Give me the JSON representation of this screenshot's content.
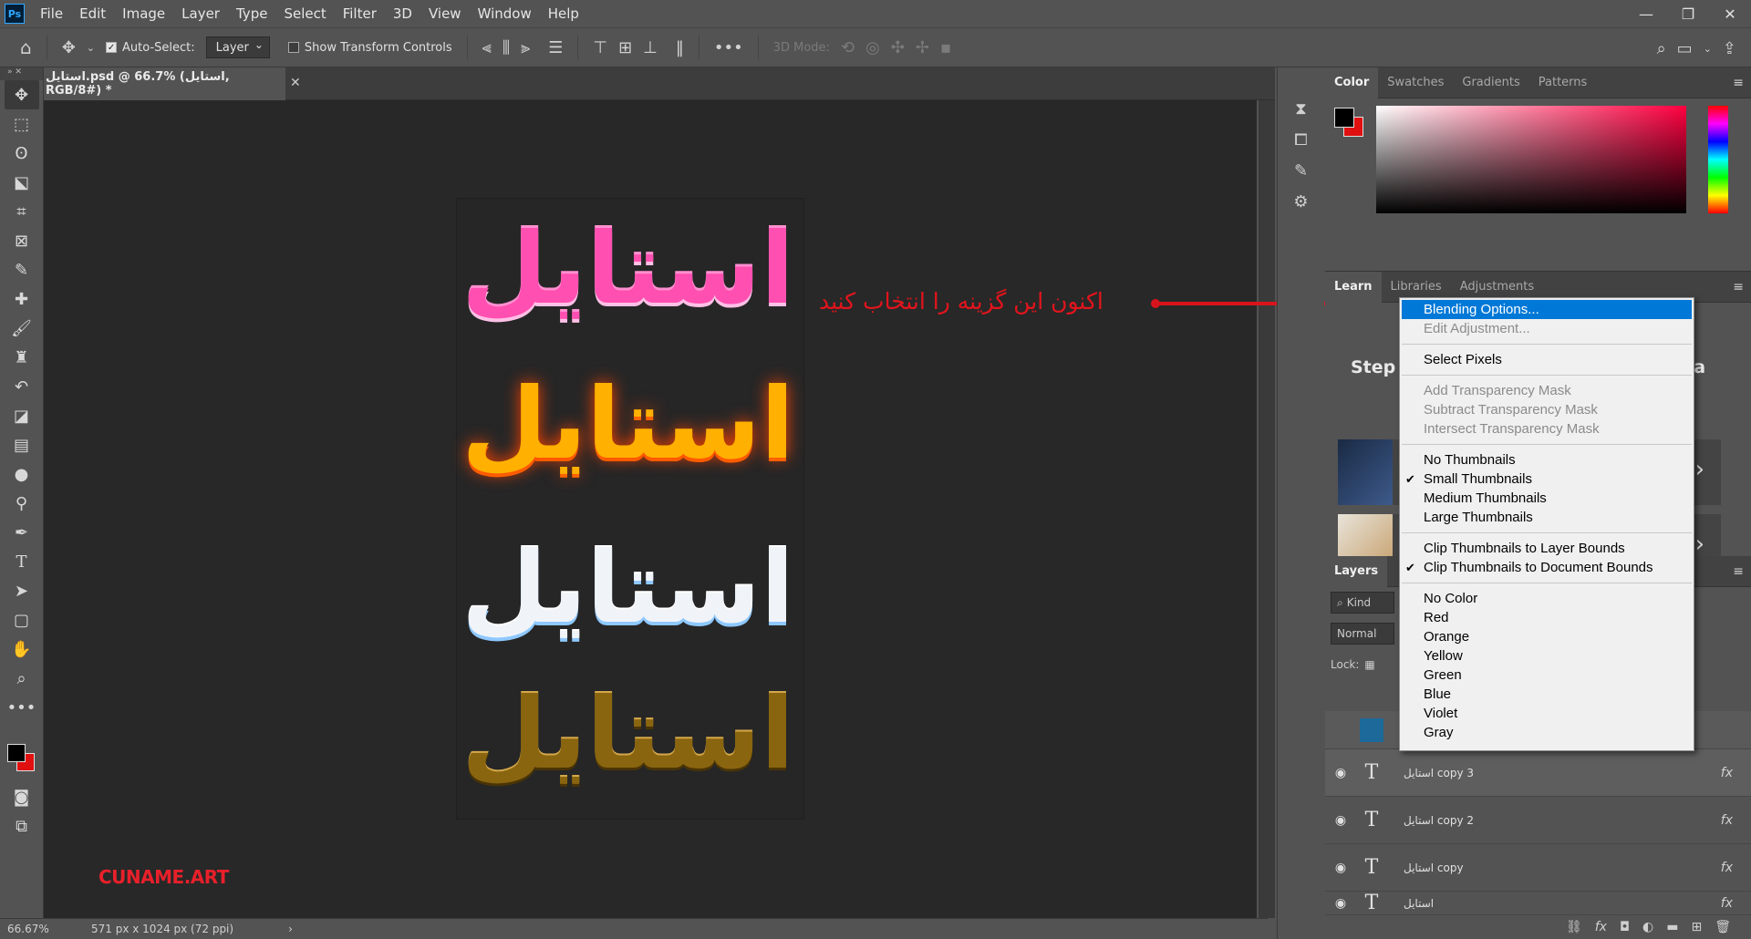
{
  "menubar": {
    "logo": "Ps",
    "items": [
      "File",
      "Edit",
      "Image",
      "Layer",
      "Type",
      "Select",
      "Filter",
      "3D",
      "View",
      "Window",
      "Help"
    ],
    "window_controls": [
      "—",
      "❐",
      "✕"
    ]
  },
  "options": {
    "auto_select_label": "Auto-Select:",
    "layer_select": "Layer",
    "transform_label": "Show Transform Controls",
    "mode_label": "3D Mode:"
  },
  "document": {
    "tab_title": "استایل.psd @ 66.7% (استایل, RGB/8#) *",
    "art_text": "استایل",
    "watermark": "CUNAME.ART"
  },
  "annotation": {
    "text": "اکنون این گزینه را انتخاب کنید",
    "color": "#e3141c"
  },
  "status": {
    "zoom": "66.67%",
    "doc_info": "571 px x 1024 px (72 ppi)",
    "arrow": "›"
  },
  "panels": {
    "color_tabs": [
      "Color",
      "Swatches",
      "Gradients",
      "Patterns"
    ],
    "learn_tabs": [
      "Learn",
      "Libraries",
      "Adjustments"
    ],
    "learn_step": "Step",
    "learn_tail": "k a",
    "layers_tab": "Layers",
    "kind_label": "Kind",
    "blend_mode": "Normal",
    "lock_label": "Lock:",
    "layers": [
      {
        "name": "استایل copy 3",
        "fx": "fx"
      },
      {
        "name": "استایل copy 2",
        "fx": "fx"
      },
      {
        "name": "استایل copy",
        "fx": "fx"
      },
      {
        "name": "استایل",
        "fx": "fx"
      }
    ]
  },
  "context_menu": {
    "groups": [
      [
        {
          "label": "Blending Options...",
          "state": "highlight"
        },
        {
          "label": "Edit Adjustment...",
          "state": "disabled"
        }
      ],
      [
        {
          "label": "Select Pixels",
          "state": "normal"
        }
      ],
      [
        {
          "label": "Add Transparency Mask",
          "state": "disabled"
        },
        {
          "label": "Subtract Transparency Mask",
          "state": "disabled"
        },
        {
          "label": "Intersect Transparency Mask",
          "state": "disabled"
        }
      ],
      [
        {
          "label": "No Thumbnails",
          "state": "normal"
        },
        {
          "label": "Small Thumbnails",
          "state": "checked"
        },
        {
          "label": "Medium Thumbnails",
          "state": "normal"
        },
        {
          "label": "Large Thumbnails",
          "state": "normal"
        }
      ],
      [
        {
          "label": "Clip Thumbnails to Layer Bounds",
          "state": "normal"
        },
        {
          "label": "Clip Thumbnails to Document Bounds",
          "state": "checked"
        }
      ],
      [
        {
          "label": "No Color",
          "state": "normal"
        },
        {
          "label": "Red",
          "state": "normal"
        },
        {
          "label": "Orange",
          "state": "normal"
        },
        {
          "label": "Yellow",
          "state": "normal"
        },
        {
          "label": "Green",
          "state": "normal"
        },
        {
          "label": "Blue",
          "state": "normal"
        },
        {
          "label": "Violet",
          "state": "normal"
        },
        {
          "label": "Gray",
          "state": "normal"
        }
      ]
    ]
  },
  "colors": {
    "foreground": "#000000",
    "background": "#e01010",
    "menu_highlight": "#0078d7"
  }
}
